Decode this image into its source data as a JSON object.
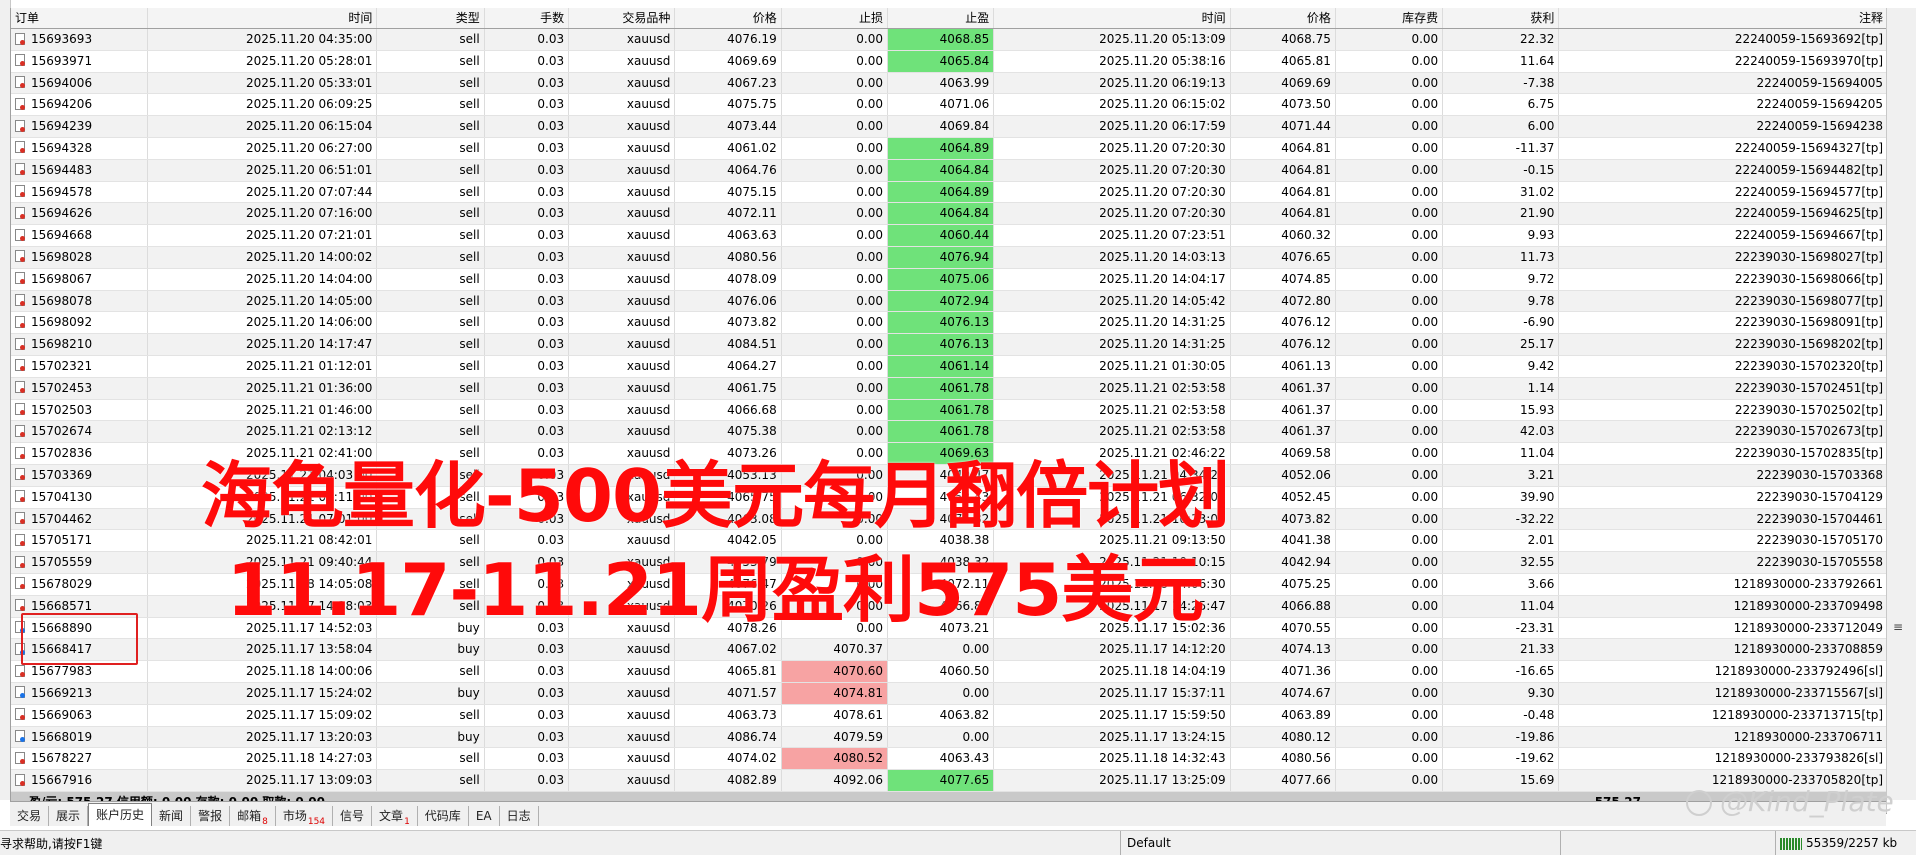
{
  "columns": {
    "order": "订单",
    "open_time": "时间",
    "type": "类型",
    "lots": "手数",
    "symbol": "交易品种",
    "price": "价格",
    "sl": "止损",
    "tp": "止盈",
    "close_time": "时间",
    "close_price": "价格",
    "swap": "库存费",
    "profit": "获利",
    "comment": "注释"
  },
  "rows": [
    {
      "order": "15693693",
      "otime": "2025.11.20 04:35:00",
      "type": "sell",
      "lots": "0.03",
      "sym": "xauusd",
      "price": "4076.19",
      "sl": "0.00",
      "tp": "4068.85",
      "tp_hl": true,
      "sl_hl": false,
      "ctime": "2025.11.20 05:13:09",
      "cprice": "4068.75",
      "swap": "0.00",
      "profit": "22.32",
      "comment": "22240059-15693692[tp]"
    },
    {
      "order": "15693971",
      "otime": "2025.11.20 05:28:01",
      "type": "sell",
      "lots": "0.03",
      "sym": "xauusd",
      "price": "4069.69",
      "sl": "0.00",
      "tp": "4065.84",
      "tp_hl": true,
      "sl_hl": false,
      "ctime": "2025.11.20 05:38:16",
      "cprice": "4065.81",
      "swap": "0.00",
      "profit": "11.64",
      "comment": "22240059-15693970[tp]"
    },
    {
      "order": "15694006",
      "otime": "2025.11.20 05:33:01",
      "type": "sell",
      "lots": "0.03",
      "sym": "xauusd",
      "price": "4067.23",
      "sl": "0.00",
      "tp": "4063.99",
      "tp_hl": false,
      "sl_hl": false,
      "ctime": "2025.11.20 06:19:13",
      "cprice": "4069.69",
      "swap": "0.00",
      "profit": "-7.38",
      "comment": "22240059-15694005"
    },
    {
      "order": "15694206",
      "otime": "2025.11.20 06:09:25",
      "type": "sell",
      "lots": "0.03",
      "sym": "xauusd",
      "price": "4075.75",
      "sl": "0.00",
      "tp": "4071.06",
      "tp_hl": false,
      "sl_hl": false,
      "ctime": "2025.11.20 06:15:02",
      "cprice": "4073.50",
      "swap": "0.00",
      "profit": "6.75",
      "comment": "22240059-15694205"
    },
    {
      "order": "15694239",
      "otime": "2025.11.20 06:15:04",
      "type": "sell",
      "lots": "0.03",
      "sym": "xauusd",
      "price": "4073.44",
      "sl": "0.00",
      "tp": "4069.84",
      "tp_hl": false,
      "sl_hl": false,
      "ctime": "2025.11.20 06:17:59",
      "cprice": "4071.44",
      "swap": "0.00",
      "profit": "6.00",
      "comment": "22240059-15694238"
    },
    {
      "order": "15694328",
      "otime": "2025.11.20 06:27:00",
      "type": "sell",
      "lots": "0.03",
      "sym": "xauusd",
      "price": "4061.02",
      "sl": "0.00",
      "tp": "4064.89",
      "tp_hl": true,
      "sl_hl": false,
      "ctime": "2025.11.20 07:20:30",
      "cprice": "4064.81",
      "swap": "0.00",
      "profit": "-11.37",
      "comment": "22240059-15694327[tp]"
    },
    {
      "order": "15694483",
      "otime": "2025.11.20 06:51:01",
      "type": "sell",
      "lots": "0.03",
      "sym": "xauusd",
      "price": "4064.76",
      "sl": "0.00",
      "tp": "4064.84",
      "tp_hl": true,
      "sl_hl": false,
      "ctime": "2025.11.20 07:20:30",
      "cprice": "4064.81",
      "swap": "0.00",
      "profit": "-0.15",
      "comment": "22240059-15694482[tp]"
    },
    {
      "order": "15694578",
      "otime": "2025.11.20 07:07:44",
      "type": "sell",
      "lots": "0.03",
      "sym": "xauusd",
      "price": "4075.15",
      "sl": "0.00",
      "tp": "4064.89",
      "tp_hl": true,
      "sl_hl": false,
      "ctime": "2025.11.20 07:20:30",
      "cprice": "4064.81",
      "swap": "0.00",
      "profit": "31.02",
      "comment": "22240059-15694577[tp]"
    },
    {
      "order": "15694626",
      "otime": "2025.11.20 07:16:00",
      "type": "sell",
      "lots": "0.03",
      "sym": "xauusd",
      "price": "4072.11",
      "sl": "0.00",
      "tp": "4064.84",
      "tp_hl": true,
      "sl_hl": false,
      "ctime": "2025.11.20 07:20:30",
      "cprice": "4064.81",
      "swap": "0.00",
      "profit": "21.90",
      "comment": "22240059-15694625[tp]"
    },
    {
      "order": "15694668",
      "otime": "2025.11.20 07:21:01",
      "type": "sell",
      "lots": "0.03",
      "sym": "xauusd",
      "price": "4063.63",
      "sl": "0.00",
      "tp": "4060.44",
      "tp_hl": true,
      "sl_hl": false,
      "ctime": "2025.11.20 07:23:51",
      "cprice": "4060.32",
      "swap": "0.00",
      "profit": "9.93",
      "comment": "22240059-15694667[tp]"
    },
    {
      "order": "15698028",
      "otime": "2025.11.20 14:00:02",
      "type": "sell",
      "lots": "0.03",
      "sym": "xauusd",
      "price": "4080.56",
      "sl": "0.00",
      "tp": "4076.94",
      "tp_hl": true,
      "sl_hl": false,
      "ctime": "2025.11.20 14:03:13",
      "cprice": "4076.65",
      "swap": "0.00",
      "profit": "11.73",
      "comment": "22239030-15698027[tp]"
    },
    {
      "order": "15698067",
      "otime": "2025.11.20 14:04:00",
      "type": "sell",
      "lots": "0.03",
      "sym": "xauusd",
      "price": "4078.09",
      "sl": "0.00",
      "tp": "4075.06",
      "tp_hl": true,
      "sl_hl": false,
      "ctime": "2025.11.20 14:04:17",
      "cprice": "4074.85",
      "swap": "0.00",
      "profit": "9.72",
      "comment": "22239030-15698066[tp]"
    },
    {
      "order": "15698078",
      "otime": "2025.11.20 14:05:00",
      "type": "sell",
      "lots": "0.03",
      "sym": "xauusd",
      "price": "4076.06",
      "sl": "0.00",
      "tp": "4072.94",
      "tp_hl": true,
      "sl_hl": false,
      "ctime": "2025.11.20 14:05:42",
      "cprice": "4072.80",
      "swap": "0.00",
      "profit": "9.78",
      "comment": "22239030-15698077[tp]"
    },
    {
      "order": "15698092",
      "otime": "2025.11.20 14:06:00",
      "type": "sell",
      "lots": "0.03",
      "sym": "xauusd",
      "price": "4073.82",
      "sl": "0.00",
      "tp": "4076.13",
      "tp_hl": true,
      "sl_hl": false,
      "ctime": "2025.11.20 14:31:25",
      "cprice": "4076.12",
      "swap": "0.00",
      "profit": "-6.90",
      "comment": "22239030-15698091[tp]"
    },
    {
      "order": "15698210",
      "otime": "2025.11.20 14:17:47",
      "type": "sell",
      "lots": "0.03",
      "sym": "xauusd",
      "price": "4084.51",
      "sl": "0.00",
      "tp": "4076.13",
      "tp_hl": true,
      "sl_hl": false,
      "ctime": "2025.11.20 14:31:25",
      "cprice": "4076.12",
      "swap": "0.00",
      "profit": "25.17",
      "comment": "22239030-15698202[tp]"
    },
    {
      "order": "15702321",
      "otime": "2025.11.21 01:12:01",
      "type": "sell",
      "lots": "0.03",
      "sym": "xauusd",
      "price": "4064.27",
      "sl": "0.00",
      "tp": "4061.14",
      "tp_hl": true,
      "sl_hl": false,
      "ctime": "2025.11.21 01:30:05",
      "cprice": "4061.13",
      "swap": "0.00",
      "profit": "9.42",
      "comment": "22239030-15702320[tp]"
    },
    {
      "order": "15702453",
      "otime": "2025.11.21 01:36:00",
      "type": "sell",
      "lots": "0.03",
      "sym": "xauusd",
      "price": "4061.75",
      "sl": "0.00",
      "tp": "4061.78",
      "tp_hl": true,
      "sl_hl": false,
      "ctime": "2025.11.21 02:53:58",
      "cprice": "4061.37",
      "swap": "0.00",
      "profit": "1.14",
      "comment": "22239030-15702451[tp]"
    },
    {
      "order": "15702503",
      "otime": "2025.11.21 01:46:00",
      "type": "sell",
      "lots": "0.03",
      "sym": "xauusd",
      "price": "4066.68",
      "sl": "0.00",
      "tp": "4061.78",
      "tp_hl": true,
      "sl_hl": false,
      "ctime": "2025.11.21 02:53:58",
      "cprice": "4061.37",
      "swap": "0.00",
      "profit": "15.93",
      "comment": "22239030-15702502[tp]"
    },
    {
      "order": "15702674",
      "otime": "2025.11.21 02:13:12",
      "type": "sell",
      "lots": "0.03",
      "sym": "xauusd",
      "price": "4075.38",
      "sl": "0.00",
      "tp": "4061.78",
      "tp_hl": true,
      "sl_hl": false,
      "ctime": "2025.11.21 02:53:58",
      "cprice": "4061.37",
      "swap": "0.00",
      "profit": "42.03",
      "comment": "22239030-15702673[tp]"
    },
    {
      "order": "15702836",
      "otime": "2025.11.21 02:41:00",
      "type": "sell",
      "lots": "0.03",
      "sym": "xauusd",
      "price": "4073.26",
      "sl": "0.00",
      "tp": "4069.63",
      "tp_hl": true,
      "sl_hl": false,
      "ctime": "2025.11.21 02:46:22",
      "cprice": "4069.58",
      "swap": "0.00",
      "profit": "11.04",
      "comment": "22239030-15702835[tp]"
    },
    {
      "order": "15703369",
      "otime": "2025.11.21 04:03:00",
      "type": "sell",
      "lots": "0.03",
      "sym": "xauusd",
      "price": "4053.13",
      "sl": "0.00",
      "tp": "4049.47",
      "tp_hl": false,
      "sl_hl": false,
      "ctime": "2025.11.21 04:34:28",
      "cprice": "4052.06",
      "swap": "0.00",
      "profit": "3.21",
      "comment": "22239030-15703368"
    },
    {
      "order": "15704130",
      "otime": "2025.11.21 06:11:00",
      "type": "sell",
      "lots": "0.03",
      "sym": "xauusd",
      "price": "4065.75",
      "sl": "0.00",
      "tp": "4052.43",
      "tp_hl": false,
      "sl_hl": false,
      "ctime": "2025.11.21 06:32:03",
      "cprice": "4052.45",
      "swap": "0.00",
      "profit": "39.90",
      "comment": "22239030-15704129"
    },
    {
      "order": "15704462",
      "otime": "2025.11.21 07:01:00",
      "type": "sell",
      "lots": "0.03",
      "sym": "xauusd",
      "price": "4063.08",
      "sl": "0.00",
      "tp": "4075.82",
      "tp_hl": false,
      "sl_hl": false,
      "ctime": "2025.11.21 10:13:00",
      "cprice": "4073.82",
      "swap": "0.00",
      "profit": "-32.22",
      "comment": "22239030-15704461"
    },
    {
      "order": "15705171",
      "otime": "2025.11.21 08:42:01",
      "type": "sell",
      "lots": "0.03",
      "sym": "xauusd",
      "price": "4042.05",
      "sl": "0.00",
      "tp": "4038.38",
      "tp_hl": false,
      "sl_hl": false,
      "ctime": "2025.11.21 09:13:50",
      "cprice": "4041.38",
      "swap": "0.00",
      "profit": "2.01",
      "comment": "22239030-15705170"
    },
    {
      "order": "15705559",
      "otime": "2025.11.21 09:40:44",
      "type": "sell",
      "lots": "0.03",
      "sym": "xauusd",
      "price": "4053.79",
      "sl": "0.00",
      "tp": "4038.32",
      "tp_hl": false,
      "sl_hl": false,
      "ctime": "2025.11.21 10:10:15",
      "cprice": "4042.94",
      "swap": "0.00",
      "profit": "32.55",
      "comment": "22239030-15705558"
    },
    {
      "order": "15678029",
      "otime": "2025.11.18 14:05:08",
      "type": "sell",
      "lots": "0.03",
      "sym": "xauusd",
      "price": "4076.47",
      "sl": "0.00",
      "tp": "4072.11",
      "tp_hl": false,
      "sl_hl": false,
      "ctime": "2025.11.18 14:06:30",
      "cprice": "4075.25",
      "swap": "0.00",
      "profit": "3.66",
      "comment": "1218930000-233792661"
    },
    {
      "order": "15668571",
      "otime": "2025.11.17 14:18:03",
      "type": "sell",
      "lots": "0.03",
      "sym": "xauusd",
      "price": "4070.26",
      "sl": "0.00",
      "tp": "4066.87",
      "tp_hl": false,
      "sl_hl": false,
      "ctime": "2025.11.17 14:25:47",
      "cprice": "4066.88",
      "swap": "0.00",
      "profit": "11.04",
      "comment": "1218930000-233709498"
    },
    {
      "order": "15668890",
      "otime": "2025.11.17 14:52:03",
      "type": "buy",
      "lots": "0.03",
      "sym": "xauusd",
      "price": "4078.26",
      "sl": "0.00",
      "tp": "4073.21",
      "tp_hl": false,
      "sl_hl": false,
      "ctime": "2025.11.17 15:02:36",
      "cprice": "4070.55",
      "swap": "0.00",
      "profit": "-23.31",
      "comment": "1218930000-233712049"
    },
    {
      "order": "15668417",
      "otime": "2025.11.17 13:58:04",
      "type": "buy",
      "lots": "0.03",
      "sym": "xauusd",
      "price": "4067.02",
      "sl": "4070.37",
      "tp": "0.00",
      "tp_hl": false,
      "sl_hl": false,
      "ctime": "2025.11.17 14:12:20",
      "cprice": "4074.13",
      "swap": "0.00",
      "profit": "21.33",
      "comment": "1218930000-233708859"
    },
    {
      "order": "15677983",
      "otime": "2025.11.18 14:00:06",
      "type": "sell",
      "lots": "0.03",
      "sym": "xauusd",
      "price": "4065.81",
      "sl": "4070.60",
      "tp": "4060.50",
      "tp_hl": false,
      "sl_hl": true,
      "ctime": "2025.11.18 14:04:19",
      "cprice": "4071.36",
      "swap": "0.00",
      "profit": "-16.65",
      "comment": "1218930000-233792496[sl]"
    },
    {
      "order": "15669213",
      "otime": "2025.11.17 15:24:02",
      "type": "buy",
      "lots": "0.03",
      "sym": "xauusd",
      "price": "4071.57",
      "sl": "4074.81",
      "tp": "0.00",
      "tp_hl": false,
      "sl_hl": true,
      "ctime": "2025.11.17 15:37:11",
      "cprice": "4074.67",
      "swap": "0.00",
      "profit": "9.30",
      "comment": "1218930000-233715567[sl]"
    },
    {
      "order": "15669063",
      "otime": "2025.11.17 15:09:02",
      "type": "sell",
      "lots": "0.03",
      "sym": "xauusd",
      "price": "4063.73",
      "sl": "4078.61",
      "tp": "4063.82",
      "tp_hl": false,
      "sl_hl": false,
      "ctime": "2025.11.17 15:59:50",
      "cprice": "4063.89",
      "swap": "0.00",
      "profit": "-0.48",
      "comment": "1218930000-233713715[tp]"
    },
    {
      "order": "15668019",
      "otime": "2025.11.17 13:20:03",
      "type": "buy",
      "lots": "0.03",
      "sym": "xauusd",
      "price": "4086.74",
      "sl": "4079.59",
      "tp": "0.00",
      "tp_hl": false,
      "sl_hl": false,
      "ctime": "2025.11.17 13:24:15",
      "cprice": "4080.12",
      "swap": "0.00",
      "profit": "-19.86",
      "comment": "1218930000-233706711"
    },
    {
      "order": "15678227",
      "otime": "2025.11.18 14:27:03",
      "type": "sell",
      "lots": "0.03",
      "sym": "xauusd",
      "price": "4074.02",
      "sl": "4080.52",
      "tp": "4063.43",
      "tp_hl": false,
      "sl_hl": true,
      "ctime": "2025.11.18 14:32:43",
      "cprice": "4080.56",
      "swap": "0.00",
      "profit": "-19.62",
      "comment": "1218930000-233793826[sl]"
    },
    {
      "order": "15667916",
      "otime": "2025.11.17 13:09:03",
      "type": "sell",
      "lots": "0.03",
      "sym": "xauusd",
      "price": "4082.89",
      "sl": "4092.06",
      "tp": "4077.65",
      "tp_hl": true,
      "sl_hl": false,
      "ctime": "2025.11.17 13:25:09",
      "cprice": "4077.66",
      "swap": "0.00",
      "profit": "15.69",
      "comment": "1218930000-233705820[tp]"
    }
  ],
  "summary": {
    "text": "盈/亏: 575.27  信用额: 0.00  存款: 0.00  取款: 0.00",
    "profit": "575.27"
  },
  "overlay": {
    "line1": "海龟量化-500美元每月翻倍计划",
    "line2": "11.17-11.21周盈利575美元",
    "color": "#ff0a0a"
  },
  "tabs": [
    {
      "label": "交易",
      "badge": ""
    },
    {
      "label": "展示",
      "badge": ""
    },
    {
      "label": "账户历史",
      "badge": "",
      "active": true
    },
    {
      "label": "新闻",
      "badge": ""
    },
    {
      "label": "警报",
      "badge": ""
    },
    {
      "label": "邮箱",
      "badge": "8"
    },
    {
      "label": "市场",
      "badge": "154"
    },
    {
      "label": "信号",
      "badge": ""
    },
    {
      "label": "文章",
      "badge": "1"
    },
    {
      "label": "代码库",
      "badge": ""
    },
    {
      "label": "EA",
      "badge": ""
    },
    {
      "label": "日志",
      "badge": ""
    }
  ],
  "status": {
    "help": "寻求帮助,请按F1键",
    "profile": "Default",
    "traffic": "55359/2257 kb"
  },
  "watermark": "@Kind_Plate",
  "colors": {
    "tp_highlight": "#6fe27a",
    "sl_highlight": "#f7a3a3"
  }
}
